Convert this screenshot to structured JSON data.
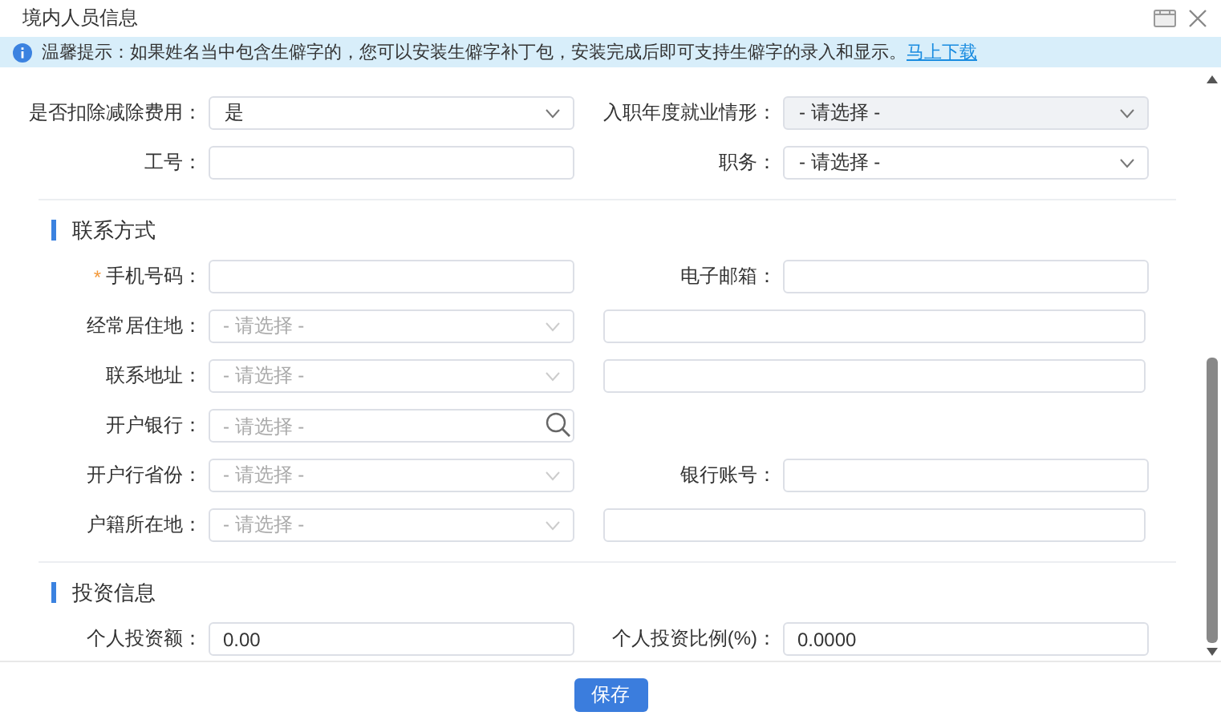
{
  "window": {
    "title": "境内人员信息"
  },
  "notice": {
    "text": "温馨提示：如果姓名当中包含生僻字的，您可以安装生僻字补丁包，安装完成后即可支持生僻字的录入和显示。",
    "link": "马上下载"
  },
  "sections": [
    {
      "rows": [
        [
          {
            "label": "是否扣除减除费用：",
            "kind": "select",
            "value": "是",
            "disabled": false
          },
          {
            "label": "入职年度就业情形：",
            "kind": "select",
            "value": "- 请选择 -",
            "disabled": true
          }
        ],
        [
          {
            "label": "工号：",
            "kind": "text",
            "disabled": false
          },
          {
            "label": "职务：",
            "kind": "select",
            "value": "- 请选择 -",
            "disabled": false
          }
        ]
      ]
    },
    {
      "title": "联系方式",
      "rows": [
        [
          {
            "label": "手机号码：",
            "marker": "*",
            "kind": "text",
            "disabled": false
          },
          {
            "label": "电子邮箱：",
            "kind": "text",
            "disabled": false
          }
        ],
        [
          {
            "label": "经常居住地：",
            "kind": "select",
            "placeholder": "- 请选择 -",
            "disabled": false
          },
          {
            "kind": "text",
            "disabled": false
          }
        ],
        [
          {
            "label": "联系地址：",
            "kind": "select",
            "placeholder": "- 请选择 -",
            "disabled": false
          },
          {
            "kind": "text",
            "disabled": false
          }
        ],
        [
          {
            "label": "开户银行：",
            "kind": "search",
            "placeholder": "- 请选择 -",
            "disabled": false
          }
        ],
        [
          {
            "label": "开户行省份：",
            "kind": "select",
            "placeholder": "- 请选择 -",
            "disabled": false
          },
          {
            "label": "银行账号：",
            "kind": "text",
            "disabled": false
          }
        ],
        [
          {
            "label": "户籍所在地：",
            "kind": "select",
            "placeholder": "- 请选择 -",
            "disabled": false
          },
          {
            "kind": "text",
            "disabled": false
          }
        ]
      ]
    },
    {
      "title": "投资信息",
      "rows": [
        [
          {
            "label": "个人投资额：",
            "kind": "text",
            "value": "0.00",
            "disabled": false
          },
          {
            "label": "个人投资比例(%)：",
            "kind": "text",
            "value": "0.0000",
            "disabled": false
          }
        ]
      ]
    }
  ],
  "buttons": [
    {
      "label": "保存"
    }
  ]
}
